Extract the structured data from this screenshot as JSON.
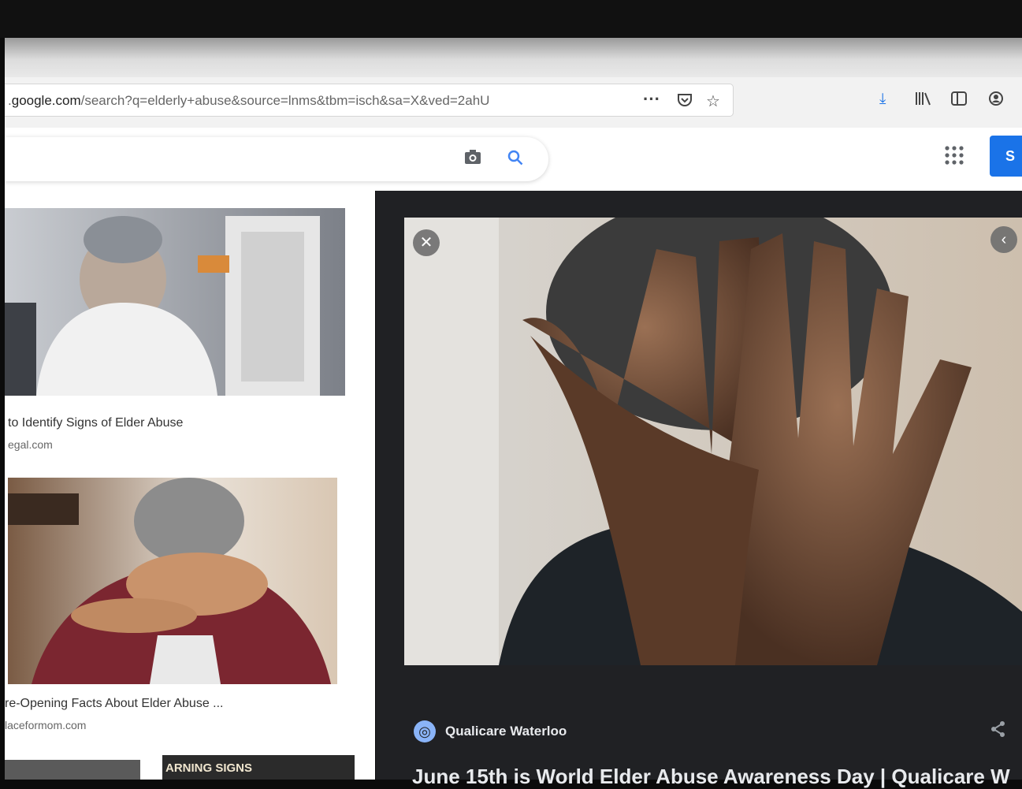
{
  "browser": {
    "url_host": "google.com",
    "url_rest": "/search?q=elderly+abuse&source=lnms&tbm=isch&sa=X&ved=2ahU",
    "url_prefix": ".",
    "more_label": "···"
  },
  "results": [
    {
      "title": "to Identify Signs of Elder Abuse",
      "source": "egal.com"
    },
    {
      "title": "re-Opening Facts About Elder Abuse ...",
      "source": "laceformom.com"
    },
    {
      "overlay_text": "ARNING SIGNS"
    }
  ],
  "viewer": {
    "source_name": "Qualicare Waterloo",
    "headline": "June 15th is World Elder Abuse Awareness Day | Qualicare W"
  },
  "header": {
    "signin_label": "S"
  },
  "icons": {
    "close": "close-icon",
    "prev": "chevron-left-icon",
    "share": "share-icon",
    "camera": "camera-icon",
    "search": "search-icon",
    "apps": "apps-grid-icon"
  },
  "colors": {
    "accent": "#1a73e8",
    "panel_bg": "#202124"
  }
}
